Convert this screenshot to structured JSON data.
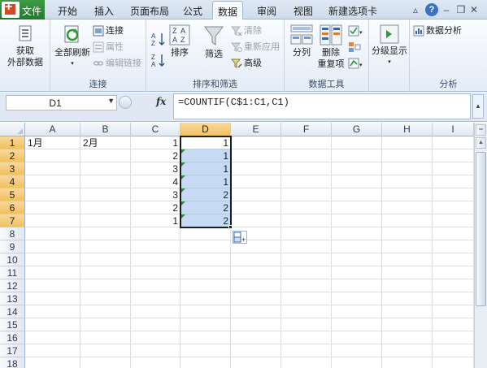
{
  "ribbon_tabs": {
    "file": "文件",
    "tabs": [
      "开始",
      "插入",
      "页面布局",
      "公式",
      "数据",
      "审阅",
      "视图",
      "新建选项卡"
    ],
    "active": "数据"
  },
  "ribbon": {
    "groups": {
      "get_external": {
        "button": [
          "获取",
          "外部数据"
        ]
      },
      "connections": {
        "label": "连接",
        "refresh_all": "全部刷新",
        "connections": "连接",
        "properties": "属性",
        "edit_links": "编辑链接"
      },
      "sort_filter": {
        "label": "排序和筛选",
        "sort": "排序",
        "filter": "筛选",
        "clear": "清除",
        "reapply": "重新应用",
        "advanced": "高级"
      },
      "data_tools": {
        "label": "数据工具",
        "text_to_columns": "分列",
        "remove_duplicates": [
          "删除",
          "重复项"
        ]
      },
      "outline": {
        "button": "分级显示"
      },
      "analysis": {
        "label": "分析",
        "data_analysis": "数据分析"
      }
    }
  },
  "formula_bar": {
    "name_box": "D1",
    "fx": "fx",
    "formula": "=COUNTIF(C$1:C1,C1)"
  },
  "sheet": {
    "columns": [
      "A",
      "B",
      "C",
      "D",
      "E",
      "F",
      "G",
      "H",
      "I"
    ],
    "selected_column": "D",
    "rows": [
      "1",
      "2",
      "3",
      "4",
      "5",
      "6",
      "7",
      "8",
      "9",
      "10",
      "11",
      "12",
      "13",
      "14",
      "15",
      "16",
      "17",
      "18"
    ],
    "selected_rows": [
      "1",
      "2",
      "3",
      "4",
      "5",
      "6",
      "7"
    ],
    "cells": {
      "A1": "1月",
      "B1": "2月",
      "C": [
        "1",
        "2",
        "3",
        "4",
        "3",
        "2",
        "1"
      ],
      "D": [
        "1",
        "1",
        "1",
        "1",
        "2",
        "2",
        "2"
      ]
    },
    "selection": "D1:D7"
  },
  "icons": {
    "help": "help-icon",
    "minimize_ribbon": "caret-up-icon",
    "close": "close-icon"
  }
}
